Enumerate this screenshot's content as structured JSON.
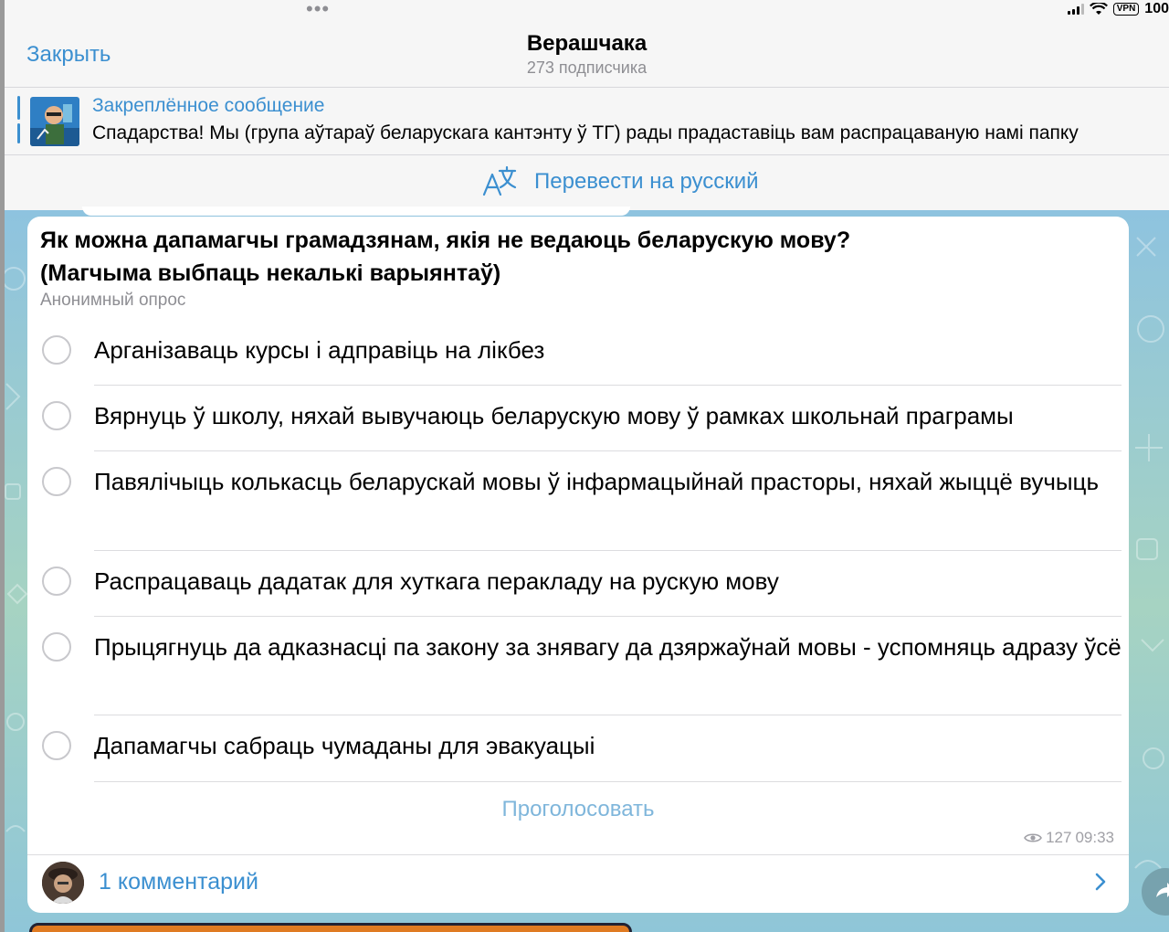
{
  "status_bar": {
    "vpn_label": "VPN",
    "battery_text": "100"
  },
  "header": {
    "close_label": "Закрыть",
    "title": "Верашчака",
    "subtitle": "273 подписчика"
  },
  "pinned": {
    "label": "Закреплённое сообщение",
    "text": "Спадарства! Мы (група аўтараў беларускага кантэнту ў ТГ) рады прадаставіць вам распрацаваную намі папку"
  },
  "translate": {
    "label": "Перевести на русский",
    "icon": "translate-icon"
  },
  "poll": {
    "question_line1": "Як можна дапамагчы грамадзянам, якія не ведаюць беларускую мову?",
    "question_line2": "(Магчыма выбпаць некалькі варыянтаў)",
    "type": "Анонимный опрос",
    "options": [
      {
        "text": "Арганізаваць курсы і адправіць на лікбез"
      },
      {
        "text": "Вярнуць ў школу, няхай вывучаюць беларускую мову ў рамках школьнай праграмы"
      },
      {
        "text": "Павялічыць колькасць беларускай мовы ў інфармацыйнай прасторы, няхай жыццё вучыць"
      },
      {
        "text": "Распрацаваць дадатак для хуткага перакладу на рускую мову"
      },
      {
        "text": "Прыцягнуць да адказнасці па закону за знявагу да дзяржаўнай мовы - успомняць адразу ўсё"
      },
      {
        "text": "Дапамагчы сабраць чумаданы для эвакуацыі"
      }
    ],
    "vote_label": "Проголосовать",
    "views": "127",
    "time": "09:33"
  },
  "comments": {
    "label": "1 комментарий"
  },
  "colors": {
    "accent": "#3b8fd0",
    "header_bg": "#f6f6f6",
    "muted": "#8e8e93"
  }
}
